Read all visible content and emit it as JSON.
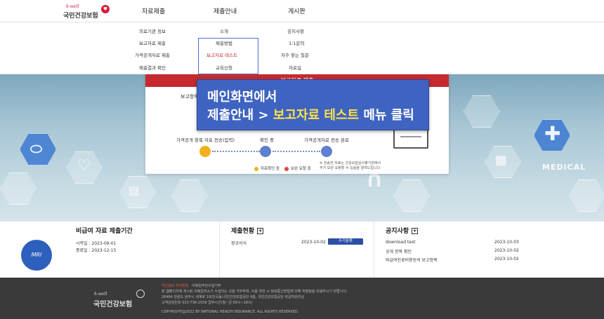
{
  "header": {
    "logo_small": "h-well",
    "logo_text": "국민건강보험",
    "nav": [
      "자료제출",
      "제출안내",
      "게시판"
    ]
  },
  "dropdown": {
    "col1": [
      "의료기관 정보",
      "보고자료 제출",
      "가격공개자료 제출",
      "제출결과 확인"
    ],
    "col2": [
      "소개",
      "제출방법",
      "보고자료 테스트",
      "교육신청"
    ],
    "col3": [
      "공지사항",
      "1:1문의",
      "자주 찾는 질문",
      "자료실"
    ]
  },
  "card": {
    "header": "보고자료 제출",
    "report_label": "보고항목",
    "steps": [
      "가격공개 항목 자료 전송(입력)",
      "확인 중",
      "가격공개자료 전송 완료"
    ],
    "legend": [
      "자료확인 중",
      "보완 요청 중"
    ],
    "note_lines": [
      "※ 전송한 자료는 건강보험심사평가원에서",
      "추가 보완 요청할 수 있음을 알려드립니다."
    ]
  },
  "callout": {
    "line1": "메인화면에서",
    "line2_prefix": "제출안내 > ",
    "line2_highlight": "보고자료 테스트",
    "line2_suffix": " 메뉴 클릭"
  },
  "hero": {
    "medical_label": "MEDICAL",
    "mri_label": "MRI"
  },
  "panels": {
    "period": {
      "title": "비급여 자료 제출기간",
      "start": "시작일 : 2023-09-01",
      "end": "종료일 : 2023-12-15"
    },
    "status": {
      "title": "제출현황",
      "rows": [
        {
          "label": "정규서식",
          "date": "2023-10-02",
          "badge": "수기분류"
        }
      ]
    },
    "notice": {
      "title": "공지사항",
      "rows": [
        {
          "label": "download test",
          "date": "2023-10-03"
        },
        {
          "label": "공개 항목 확인",
          "date": "2023-10-02"
        },
        {
          "label": "비급여진료비용등의 보고항목",
          "date": "2023-10-02"
        }
      ]
    }
  },
  "footer": {
    "logo_small": "h-well",
    "logo_text": "국민건강보험",
    "links": [
      "개인정보 처리방침",
      "이메일무단수집거부"
    ],
    "line1": "본 웹페이지에 게시된 이메일주소가 수집되는 것을 거부하며, 이를 위반 시 정보통신망법에 의해 처벌됨을 유념하시기 바랍니다.",
    "line2": "26464 강원도 원주시 세계로 10(반곡동)국민건강보험공단 9층, 국민건강보험공단 비급여관리실",
    "line3": "고객상담번호 033-736-2039 업무시간(월~금 09시~18시)",
    "copyright": "COPYRIGHT@2022 BY NATIONAL HEALTH INSURANCE. ALL RIGHTS RESERVED."
  },
  "colors": {
    "accent_blue": "#3e63c0",
    "highlight_yellow": "#ffe24a",
    "brand_red": "#c62a2f",
    "step_done": "#f2b01e",
    "step_pending": "#5f80cf",
    "footer_bg": "#3a3a3a"
  }
}
